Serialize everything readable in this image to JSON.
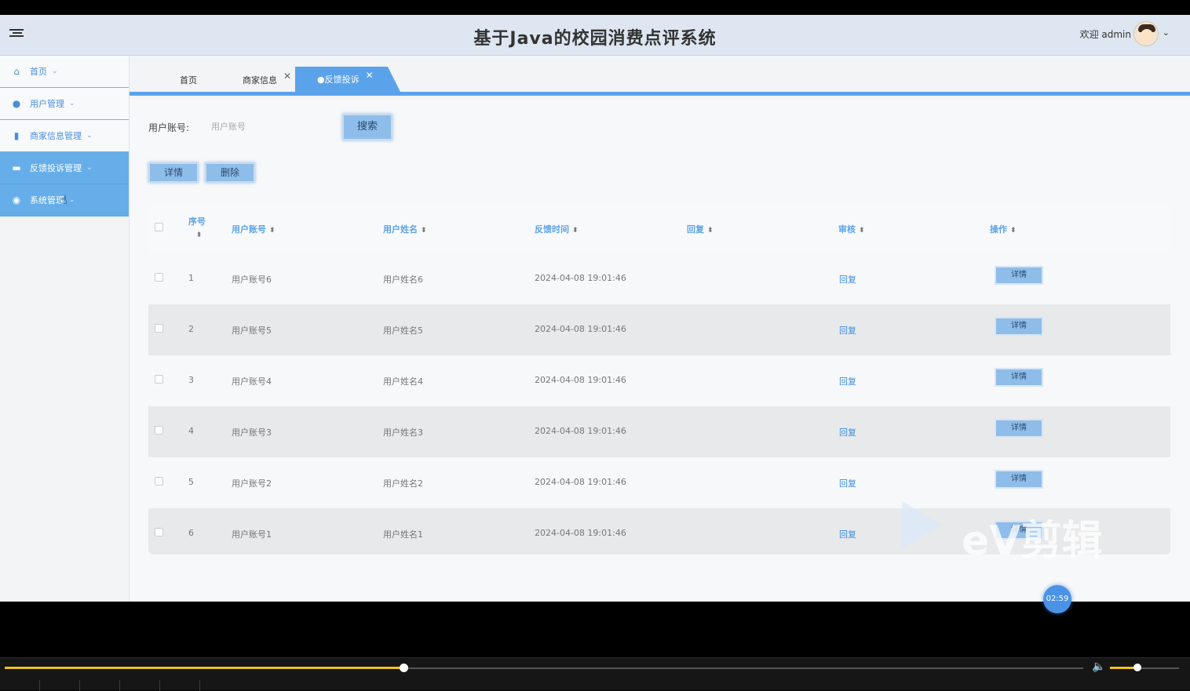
{
  "header": {
    "title": "基于Java的校园消费点评系统",
    "welcome": "欢迎 admin"
  },
  "sidebar": {
    "items": [
      {
        "label": "首页",
        "icon": "home-icon"
      },
      {
        "label": "用户管理",
        "icon": "user-icon"
      },
      {
        "label": "商家信息管理",
        "icon": "store-icon"
      },
      {
        "label": "反馈投诉管理",
        "icon": "feedback-icon"
      },
      {
        "label": "系统管理",
        "icon": "settings-icon"
      }
    ]
  },
  "tabs": [
    {
      "label": "首页"
    },
    {
      "label": "商家信息"
    },
    {
      "label": "●反馈投诉"
    }
  ],
  "search": {
    "label": "用户账号:",
    "placeholder": "用户账号",
    "button": "搜索"
  },
  "actions": {
    "detail": "详情",
    "delete": "删除"
  },
  "table": {
    "headers": {
      "index": "序号",
      "account": "用户账号",
      "name": "用户姓名",
      "time": "反馈时间",
      "reply": "回复",
      "review": "审核",
      "operation": "操作"
    },
    "rows": [
      {
        "index": "1",
        "account": "用户账号6",
        "name": "用户姓名6",
        "time": "2024-04-08 19:01:46",
        "review": "回复",
        "op": "详情"
      },
      {
        "index": "2",
        "account": "用户账号5",
        "name": "用户姓名5",
        "time": "2024-04-08 19:01:46",
        "review": "回复",
        "op": "详情"
      },
      {
        "index": "3",
        "account": "用户账号4",
        "name": "用户姓名4",
        "time": "2024-04-08 19:01:46",
        "review": "回复",
        "op": "详情"
      },
      {
        "index": "4",
        "account": "用户账号3",
        "name": "用户姓名3",
        "time": "2024-04-08 19:01:46",
        "review": "回复",
        "op": "详情"
      },
      {
        "index": "5",
        "account": "用户账号2",
        "name": "用户姓名2",
        "time": "2024-04-08 19:01:46",
        "review": "回复",
        "op": "详情"
      },
      {
        "index": "6",
        "account": "用户账号1",
        "name": "用户姓名1",
        "time": "2024-04-08 19:01:46",
        "review": "回复",
        "op": "详情"
      }
    ]
  },
  "overlay": {
    "timestamp": "02:59",
    "watermark": "eV剪辑"
  },
  "player": {
    "progress_fraction": 0.37,
    "volume_fraction": 0.4
  },
  "colors": {
    "accent": "#5aa3ea",
    "header_bg": "#dde6f1",
    "button": "#8fbde9",
    "progress": "#f2c11f"
  }
}
